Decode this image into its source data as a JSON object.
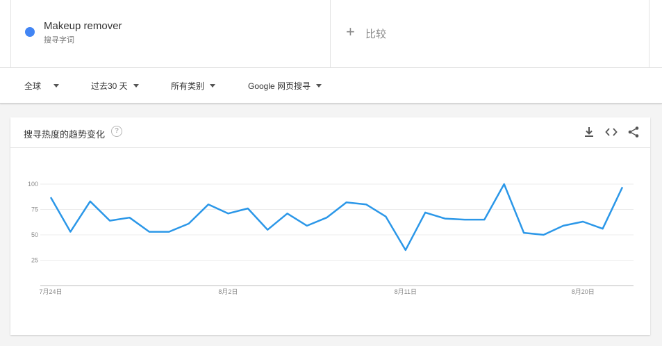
{
  "term": {
    "name": "Makeup remover",
    "sublabel": "搜寻字词",
    "color": "#4285f4"
  },
  "compare": {
    "label": "比较"
  },
  "filters": [
    {
      "label": "全球"
    },
    {
      "label": "过去30 天"
    },
    {
      "label": "所有类别"
    },
    {
      "label": "Google 网页搜寻"
    }
  ],
  "card": {
    "title": "搜寻热度的趋势变化",
    "icons": [
      "download-icon",
      "embed-icon",
      "share-icon"
    ]
  },
  "chart_data": {
    "type": "line",
    "line_color": "#2b97e8",
    "x_start": "7月24日",
    "x_ticks": [
      {
        "label": "7月24日",
        "index": 0
      },
      {
        "label": "8月2日",
        "index": 9
      },
      {
        "label": "8月11日",
        "index": 18
      },
      {
        "label": "8月20日",
        "index": 27
      }
    ],
    "y_ticks": [
      25,
      50,
      75,
      100
    ],
    "ylim": [
      0,
      100
    ],
    "grid": true,
    "series": [
      {
        "values": [
          87,
          53,
          83,
          64,
          67,
          53,
          53,
          61,
          80,
          71,
          76,
          55,
          71,
          59,
          67,
          82,
          80,
          68,
          35,
          72,
          66,
          65,
          65,
          100,
          52,
          50,
          59,
          63,
          56,
          97
        ]
      }
    ]
  }
}
